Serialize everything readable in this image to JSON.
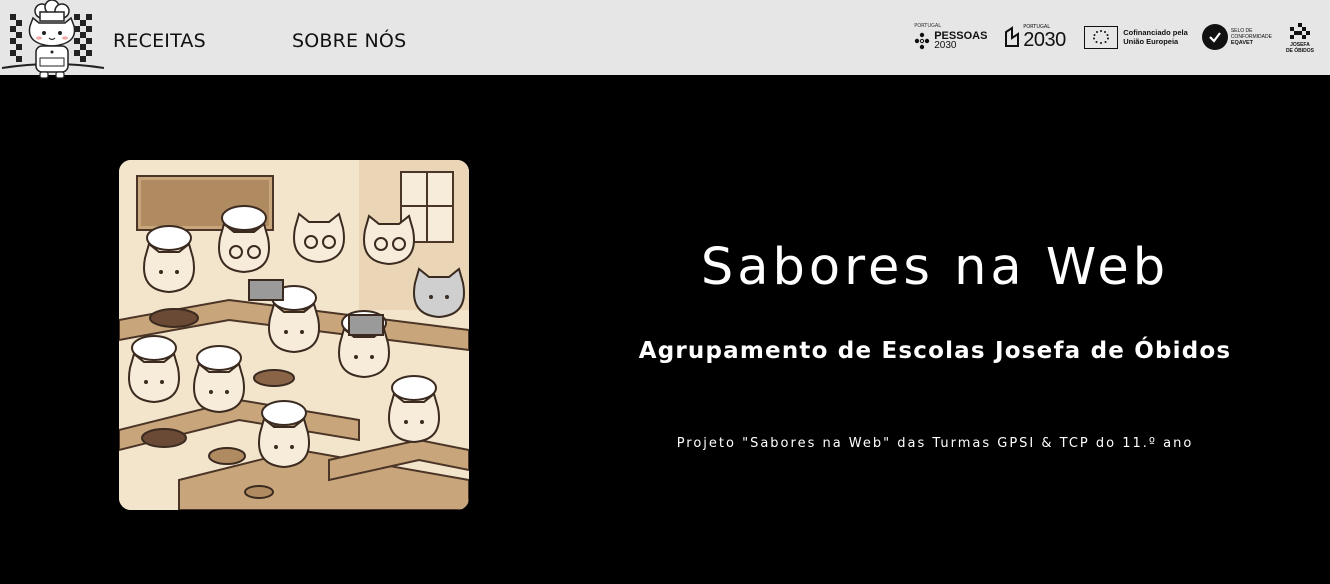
{
  "header": {
    "nav": [
      {
        "label": "RECEITAS"
      },
      {
        "label": "SOBRE NÓS"
      }
    ],
    "partners": {
      "pessoas_top": "PORTUGAL",
      "pessoas_name": "PESSOAS",
      "pessoas_year": "2030",
      "portugal_top": "PORTUGAL",
      "portugal_year": "2030",
      "eu_line1": "Cofinanciado pela",
      "eu_line2": "União Europeia",
      "eqavet_line1": "SELO DE",
      "eqavet_line2": "CONFORMIDADE",
      "eqavet_line3": "EQAVET",
      "aejo_line1": "JOSEFA",
      "aejo_line2": "DE ÓBIDOS"
    }
  },
  "hero": {
    "title": "Sabores na Web",
    "subtitle": "Agrupamento de Escolas Josefa de Óbidos",
    "caption": "Projeto \"Sabores na Web\" das Turmas GPSI & TCP do 11.º ano"
  },
  "colors": {
    "header_bg": "#e6e6e6",
    "page_bg": "#000000",
    "hero_text": "#ffffff",
    "illustration_cream": "#f3e4cc",
    "illustration_wood": "#c9a57b"
  }
}
